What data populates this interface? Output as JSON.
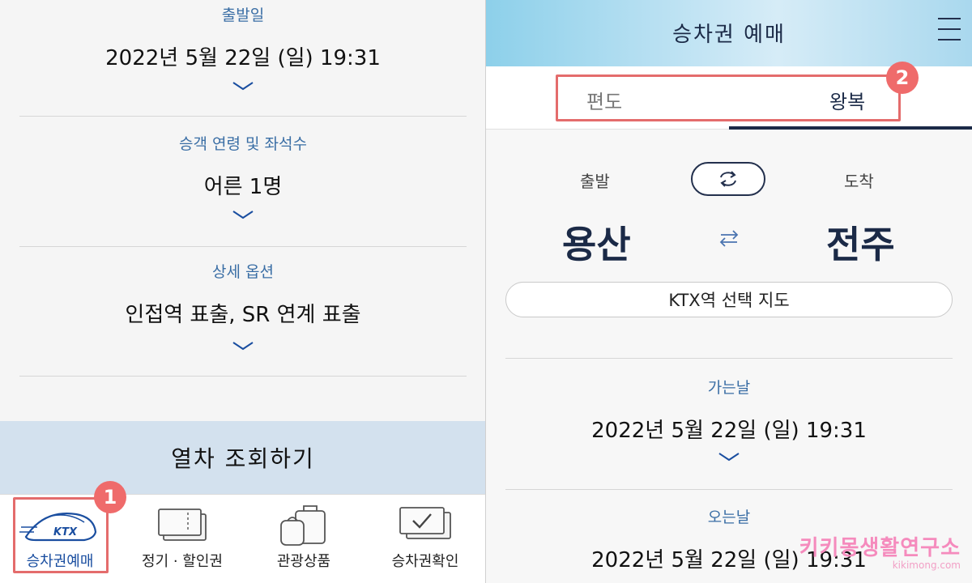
{
  "left": {
    "departure": {
      "label": "출발일",
      "value": "2022년 5월 22일 (일) 19:31"
    },
    "passengers": {
      "label": "승객 연령 및 좌석수",
      "value": "어른 1명"
    },
    "options": {
      "label": "상세 옵션",
      "value": "인접역 표출, SR 연계 표출"
    },
    "search_button": "열차 조회하기",
    "nav": [
      {
        "label": "승차권예매",
        "icon": "ktx-train-icon",
        "active": true
      },
      {
        "label": "정기 · 할인권",
        "icon": "pass-ticket-icon"
      },
      {
        "label": "관광상품",
        "icon": "luggage-icon"
      },
      {
        "label": "승차권확인",
        "icon": "ticket-check-icon"
      }
    ],
    "badge": "1",
    "ktx_logo_text": "KTX"
  },
  "right": {
    "title": "승차권 예매",
    "tabs": {
      "oneway": "편도",
      "roundtrip": "왕복"
    },
    "badge": "2",
    "departure_label": "출발",
    "arrival_label": "도착",
    "departure_station": "용산",
    "arrival_station": "전주",
    "map_button": "KTX역 선택 지도",
    "outbound": {
      "label": "가는날",
      "value": "2022년 5월 22일 (일) 19:31"
    },
    "inbound": {
      "label": "오는날",
      "value": "2022년 5월 22일 (일) 19:31"
    }
  },
  "watermark": {
    "main": "키키몽생활연구소",
    "sub": "kikimong.com"
  },
  "colors": {
    "accent": "#3a6ea5",
    "navy": "#1b2a47",
    "highlight": "#e46c6c",
    "search_bg": "#d3e1ee"
  }
}
